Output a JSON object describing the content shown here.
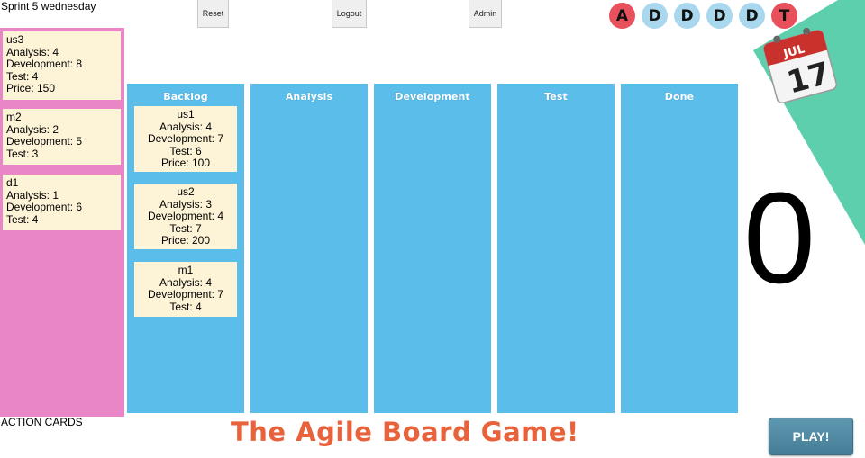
{
  "header": {
    "sprint_label": "Sprint 5 wednesday",
    "reset_label": "Reset",
    "logout_label": "Logout",
    "admin_label": "Admin"
  },
  "players": [
    {
      "letter": "A",
      "color": "#e8505b"
    },
    {
      "letter": "D",
      "color": "#a9d7ee"
    },
    {
      "letter": "D",
      "color": "#a9d7ee"
    },
    {
      "letter": "D",
      "color": "#a9d7ee"
    },
    {
      "letter": "D",
      "color": "#a9d7ee"
    },
    {
      "letter": "T",
      "color": "#e8505b"
    }
  ],
  "calendar": {
    "month": "JUL",
    "day": "17"
  },
  "action_cards": {
    "label": "ACTION CARDS",
    "cards": [
      {
        "name": "us3",
        "lines": [
          "Analysis: 4",
          "Development: 8",
          "Test: 4",
          "Price: 150"
        ]
      },
      {
        "name": "m2",
        "lines": [
          "Analysis: 2",
          "Development: 5",
          "Test: 3"
        ]
      },
      {
        "name": "d1",
        "lines": [
          "Analysis: 1",
          "Development: 6",
          "Test: 4"
        ]
      }
    ]
  },
  "columns": [
    {
      "title": "Backlog",
      "cards": [
        {
          "name": "us1",
          "lines": [
            "Analysis: 4",
            "Development: 7",
            "Test: 6",
            "Price: 100"
          ]
        },
        {
          "name": "us2",
          "lines": [
            "Analysis: 3",
            "Development: 4",
            "Test: 7",
            "Price: 200"
          ]
        },
        {
          "name": "m1",
          "lines": [
            "Analysis: 4",
            "Development: 7",
            "Test: 4"
          ]
        }
      ]
    },
    {
      "title": "Analysis",
      "cards": []
    },
    {
      "title": "Development",
      "cards": []
    },
    {
      "title": "Test",
      "cards": []
    },
    {
      "title": "Done",
      "cards": []
    }
  ],
  "score": "0",
  "footer": {
    "title": "The Agile Board Game!",
    "play_label": "PLAY!"
  },
  "colors": {
    "column_blue": "#5bbde9",
    "action_pink": "#e986c8",
    "card_cream": "#fdf3d7",
    "corner_green": "#5dcfac",
    "title_orange": "#e8623c"
  }
}
